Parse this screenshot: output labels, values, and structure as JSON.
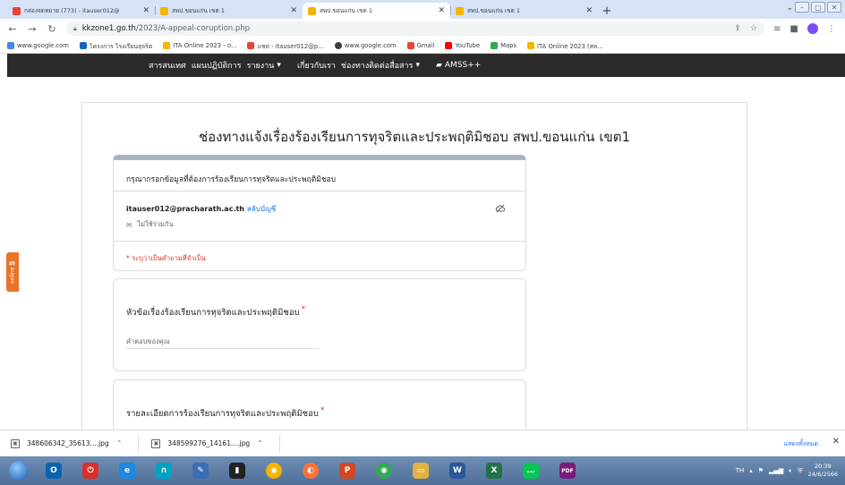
{
  "browser": {
    "tabs": [
      {
        "title": "กล่องจดหมาย (773) - itauser012@",
        "favicon_color": "#ea4335",
        "active": false
      },
      {
        "title": "สพป.ขอนแก่น เขต 1",
        "favicon_color": "#f4b400",
        "active": false
      },
      {
        "title": "สพป.ขอนแก่น เขต 1",
        "favicon_color": "#f4b400",
        "active": true
      },
      {
        "title": "สพป.ขอนแก่น เขต 1",
        "favicon_color": "#f4b400",
        "active": false
      }
    ],
    "url_host": "kkzone1.go.th",
    "url_path": "/2023/A-appeal-coruption.php",
    "bookmarks": [
      {
        "label": "www.google.com",
        "icon": "google-icon",
        "color": "#4285f4"
      },
      {
        "label": "โครงการ โรงเรียนสุจริต",
        "icon": "school-icon",
        "color": "#1565c0"
      },
      {
        "label": "ITA Online 2023 - o...",
        "icon": "ita-icon",
        "color": "#f4b400"
      },
      {
        "label": "แชท - itauser012@p...",
        "icon": "gmail-icon",
        "color": "#ea4335"
      },
      {
        "label": "www.google.com",
        "icon": "globe-icon",
        "color": "#3c4043"
      },
      {
        "label": "Gmail",
        "icon": "gmail-icon",
        "color": "#ea4335"
      },
      {
        "label": "YouTube",
        "icon": "youtube-icon",
        "color": "#ff0000"
      },
      {
        "label": "Maps",
        "icon": "maps-icon",
        "color": "#34a853"
      },
      {
        "label": "ITA Online 2023 (สท...",
        "icon": "ita-icon",
        "color": "#f4b400"
      }
    ]
  },
  "site_nav": {
    "items": [
      {
        "label": "สารสนเทศ"
      },
      {
        "label": "แผนปฏิบัติการ"
      },
      {
        "label": "รายงาน",
        "dropdown": true
      },
      {
        "label": "เกี่ยวกับเรา"
      },
      {
        "label": "ช่องทางติดต่อสื่อสาร",
        "dropdown": true
      },
      {
        "label": "AMSS++",
        "icon": "book-icon"
      }
    ]
  },
  "online_badge": {
    "label": "online",
    "count": "5"
  },
  "form": {
    "title": "ช่องทางแจ้งเรื่องร้องเรียนการทุจริตและประพฤติมิชอบ สพป.ขอนแก่น เขต1",
    "description": "กรุณากรอกข้อมูลที่ต้องการร้องเรียนการทุจริตและประพฤติมิชอบ",
    "account_email": "itauser012@pracharath.ac.th",
    "switch_account": "สลับบัญชี",
    "not_shared": "ไม่ใช้ร่วมกัน",
    "required_note": "* ระบุว่าเป็นคำถามที่จำเป็น",
    "questions": [
      {
        "title": "หัวข้อเรื่องร้องเรียนการทุจริตและประพฤติมิชอบ",
        "required_mark": "*",
        "placeholder": "คำตอบของคุณ"
      },
      {
        "title": "รายละเอียดการร้องเรียนการทุจริตและประพฤติมิชอบ",
        "required_mark": "*"
      }
    ]
  },
  "downloads": {
    "items": [
      {
        "name": "348606342_35613....jpg"
      },
      {
        "name": "348599276_14161....jpg"
      }
    ],
    "show_all": "แสดงทั้งหมด"
  },
  "taskbar": {
    "apps": [
      {
        "name": "start-orb",
        "color": "#1b5aa8"
      },
      {
        "name": "outlook-icon",
        "color": "#0a64ad",
        "glyph": "O"
      },
      {
        "name": "power-icon",
        "color": "#d9302b",
        "glyph": "⏻"
      },
      {
        "name": "ie-icon",
        "color": "#1e88e5",
        "glyph": "e"
      },
      {
        "name": "headset-icon",
        "color": "#00a3c4",
        "glyph": "∩"
      },
      {
        "name": "pen-icon",
        "color": "#3a6fb0",
        "glyph": "✎"
      },
      {
        "name": "terminal-icon",
        "color": "#222222",
        "glyph": "▮"
      },
      {
        "name": "chrome-icon",
        "color": "#f4b400",
        "glyph": "◉"
      },
      {
        "name": "firefox-icon",
        "color": "#ff7139",
        "glyph": "◐"
      },
      {
        "name": "powerpoint-icon",
        "color": "#d24726",
        "glyph": "P"
      },
      {
        "name": "chrome-icon",
        "color": "#34a853",
        "glyph": "◉"
      },
      {
        "name": "explorer-icon",
        "color": "#e3b341",
        "glyph": "▭"
      },
      {
        "name": "word-icon",
        "color": "#2b579a",
        "glyph": "W"
      },
      {
        "name": "excel-icon",
        "color": "#217346",
        "glyph": "X"
      },
      {
        "name": "line-icon",
        "color": "#06c755",
        "glyph": "…"
      },
      {
        "name": "pdf-icon",
        "color": "#7a1b7a",
        "glyph": "PDF"
      }
    ],
    "lang": "TH",
    "time": "20:39",
    "date": "24/6/2566"
  }
}
